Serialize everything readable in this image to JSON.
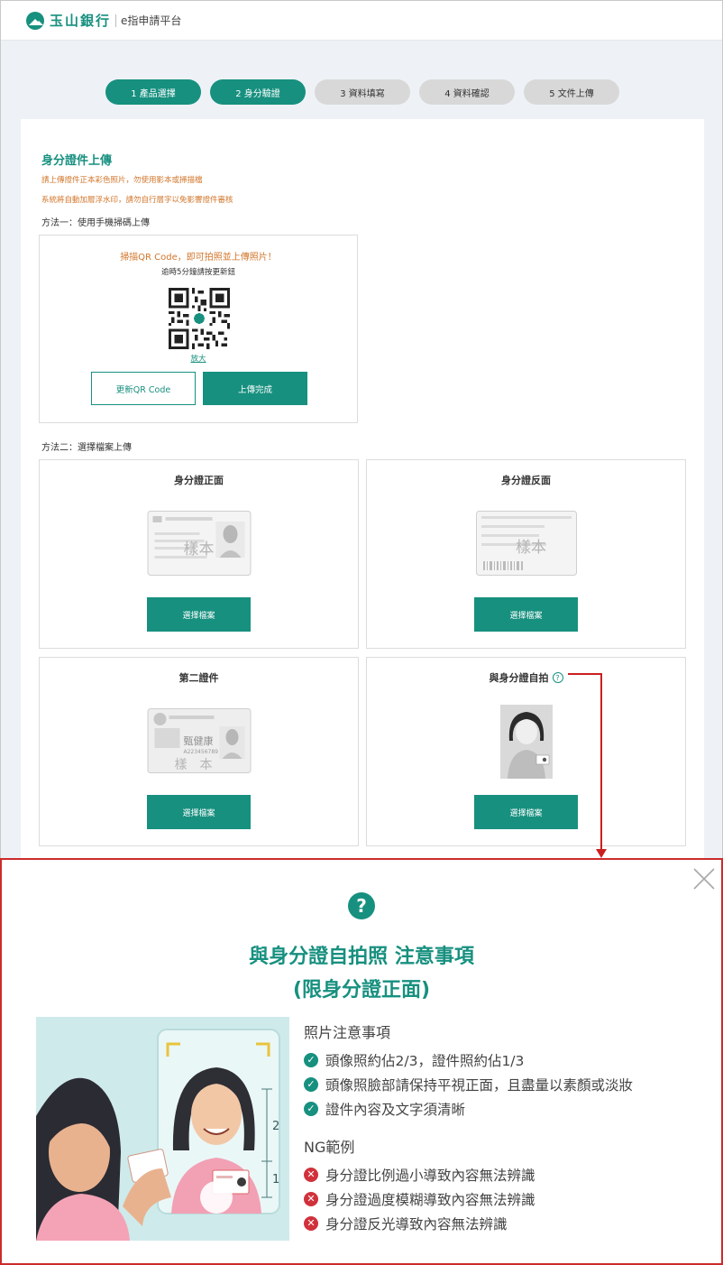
{
  "header": {
    "brand": "玉山銀行",
    "subtitle": "e指申請平台"
  },
  "steps": [
    {
      "label": "1 產品選擇",
      "state": "active"
    },
    {
      "label": "2 身分驗證",
      "state": "active"
    },
    {
      "label": "3 資料填寫",
      "state": "inactive"
    },
    {
      "label": "4 資料確認",
      "state": "inactive"
    },
    {
      "label": "5 文件上傳",
      "state": "inactive"
    }
  ],
  "upload": {
    "title": "身分證件上傳",
    "note1": "請上傳證件正本彩色照片，勿使用影本或掃描檔",
    "note2": "系統將自動加層浮水印，請勿自行層字以免影響證件審核",
    "method1": "方法一：使用手機掃碼上傳",
    "method2": "方法二：選擇檔案上傳"
  },
  "qr": {
    "headline": "掃描QR Code，即可拍照並上傳照片！",
    "hint": "逾時5分鐘請按更新鈕",
    "zoom_label": "放大",
    "refresh_label": "更新QR Code",
    "done_label": "上傳完成"
  },
  "documents": [
    {
      "title": "身分證正面",
      "button": "選擇檔案"
    },
    {
      "title": "身分證反面",
      "button": "選擇檔案"
    },
    {
      "title": "第二證件",
      "button": "選擇檔案"
    },
    {
      "title": "與身分證自拍",
      "button": "選擇檔案"
    }
  ],
  "sample_card": {
    "name": "甄健康",
    "id_no": "A223456789",
    "watermark": "樣　本",
    "watermark_short": "樣本"
  },
  "help_glyph": "?",
  "modal": {
    "title": "與身分證自拍照 注意事項",
    "subtitle": "(限身分證正面)",
    "notes_head": "照片注意事項",
    "notes": [
      "頭像照約佔2/3，證件照約佔1/3",
      "頭像照臉部請保持平視正面，且盡量以素顏或淡妝",
      "證件內容及文字須清晰"
    ],
    "ng_head": "NG範例",
    "ng": [
      "身分證比例過小導致內容無法辨識",
      "身分證過度模糊導致內容無法辨識",
      "身分證反光導致內容無法辨識"
    ],
    "scale_top": "2",
    "scale_bottom": "1"
  },
  "colors": {
    "brand": "#17907f",
    "note": "#d2762b",
    "alert": "#cc2b2b"
  }
}
